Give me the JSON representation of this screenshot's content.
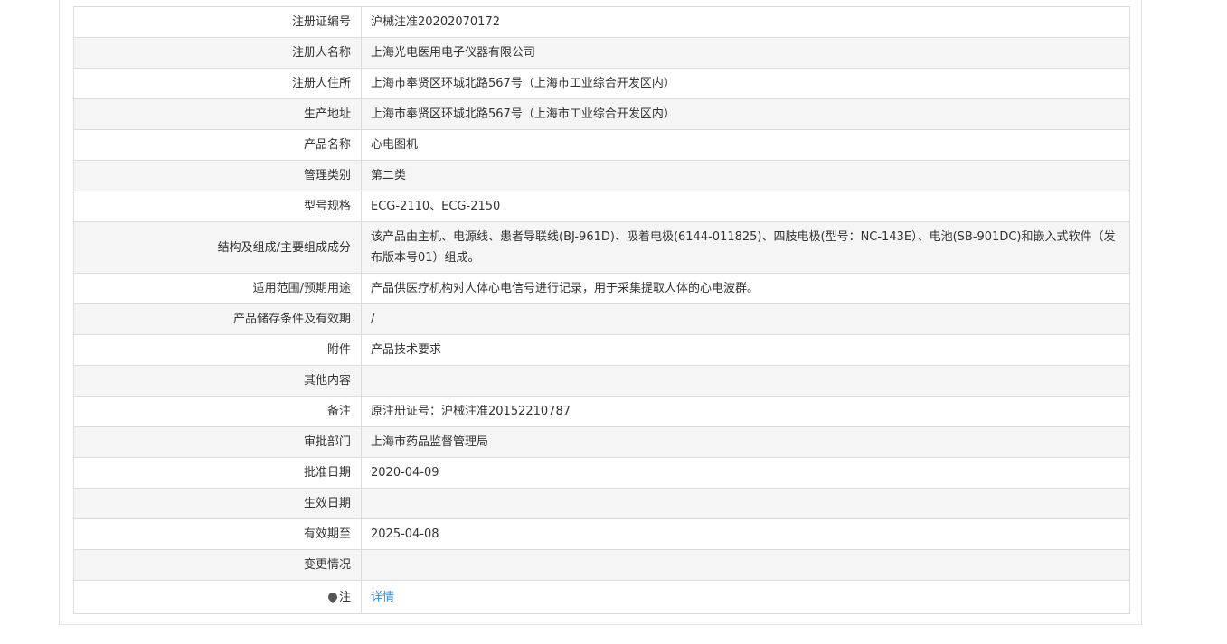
{
  "rows": [
    {
      "label": "注册证编号",
      "value": "沪械注准20202070172"
    },
    {
      "label": "注册人名称",
      "value": "上海光电医用电子仪器有限公司"
    },
    {
      "label": "注册人住所",
      "value": "上海市奉贤区环城北路567号（上海市工业综合开发区内）"
    },
    {
      "label": "生产地址",
      "value": "上海市奉贤区环城北路567号（上海市工业综合开发区内）"
    },
    {
      "label": "产品名称",
      "value": "心电图机"
    },
    {
      "label": "管理类别",
      "value": "第二类"
    },
    {
      "label": "型号规格",
      "value": "ECG-2110、ECG-2150"
    },
    {
      "label": "结构及组成/主要组成成分",
      "value": "该产品由主机、电源线、患者导联线(BJ-961D)、吸着电极(6144-011825)、四肢电极(型号：NC-143E）、电池(SB-901DC)和嵌入式软件（发布版本号01）组成。"
    },
    {
      "label": "适用范围/预期用途",
      "value": "产品供医疗机构对人体心电信号进行记录，用于采集提取人体的心电波群。"
    },
    {
      "label": "产品储存条件及有效期",
      "value": "/"
    },
    {
      "label": "附件",
      "value": "产品技术要求"
    },
    {
      "label": "其他内容",
      "value": ""
    },
    {
      "label": "备注",
      "value": "原注册证号：沪械注准20152210787"
    },
    {
      "label": "审批部门",
      "value": "上海市药品监督管理局"
    },
    {
      "label": "批准日期",
      "value": "2020-04-09"
    },
    {
      "label": "生效日期",
      "value": ""
    },
    {
      "label": "有效期至",
      "value": "2025-04-08"
    },
    {
      "label": "变更情况",
      "value": ""
    }
  ],
  "note": {
    "label": "注",
    "icon": "map-pin-icon",
    "link_text": "详情",
    "link_color": "#2a8bd8"
  }
}
